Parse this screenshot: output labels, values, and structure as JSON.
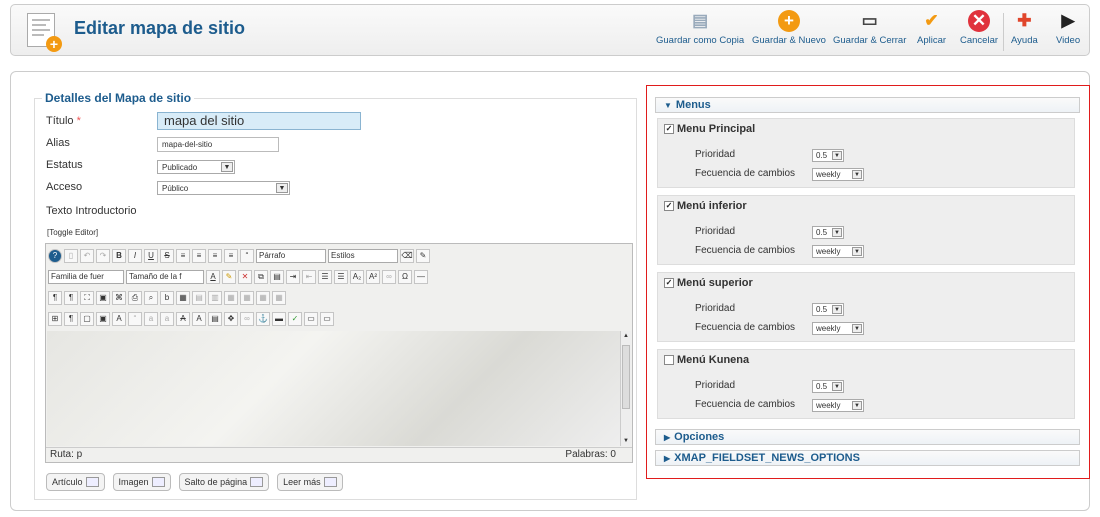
{
  "header": {
    "title": "Editar mapa de sitio",
    "buttons": [
      {
        "label": "Guardar como Copia",
        "icon": "copy-icon"
      },
      {
        "label": "Guardar & Nuevo",
        "icon": "plus-circle-icon"
      },
      {
        "label": "Guardar & Cerrar",
        "icon": "save-icon"
      },
      {
        "label": "Aplicar",
        "icon": "check-icon"
      },
      {
        "label": "Cancelar",
        "icon": "cancel-icon"
      },
      {
        "label": "Ayuda",
        "icon": "help-icon"
      },
      {
        "label": "Video",
        "icon": "video-icon"
      }
    ]
  },
  "details": {
    "legend": "Detalles del Mapa de sitio",
    "titulo_label": "Título",
    "required_mark": "*",
    "titulo_value": "mapa del sitio",
    "alias_label": "Alias",
    "alias_value": "mapa-del-sitio",
    "estatus_label": "Estatus",
    "estatus_value": "Publicado",
    "acceso_label": "Acceso",
    "acceso_value": "Público",
    "intro_label": "Texto Introductorio",
    "toggle_editor": "[Toggle Editor]"
  },
  "editor": {
    "format_select": "Párrafo",
    "styles_select": "Estilos",
    "font_family_select": "Familia de fuer",
    "font_size_select": "Tamaño de la f",
    "path_label": "Ruta: p",
    "words_label": "Palabras: 0"
  },
  "editor_buttons": [
    "Artículo",
    "Imagen",
    "Salto de página",
    "Leer más"
  ],
  "right": {
    "menus_title": "Menus",
    "priority_label": "Prioridad",
    "freq_label": "Fecuencia de cambios",
    "menus": [
      {
        "name": "Menu Principal",
        "checked": true,
        "priority": "0.5",
        "freq": "weekly"
      },
      {
        "name": "Menú inferior",
        "checked": true,
        "priority": "0.5",
        "freq": "weekly"
      },
      {
        "name": "Menú superior",
        "checked": true,
        "priority": "0.5",
        "freq": "weekly"
      },
      {
        "name": "Menú Kunena",
        "checked": false,
        "priority": "0.5",
        "freq": "weekly"
      }
    ],
    "opciones_title": "Opciones",
    "news_title": "XMAP_FIELDSET_NEWS_OPTIONS"
  },
  "colors": {
    "accent": "#1d5c8d",
    "highlight": "#e01c1c"
  }
}
